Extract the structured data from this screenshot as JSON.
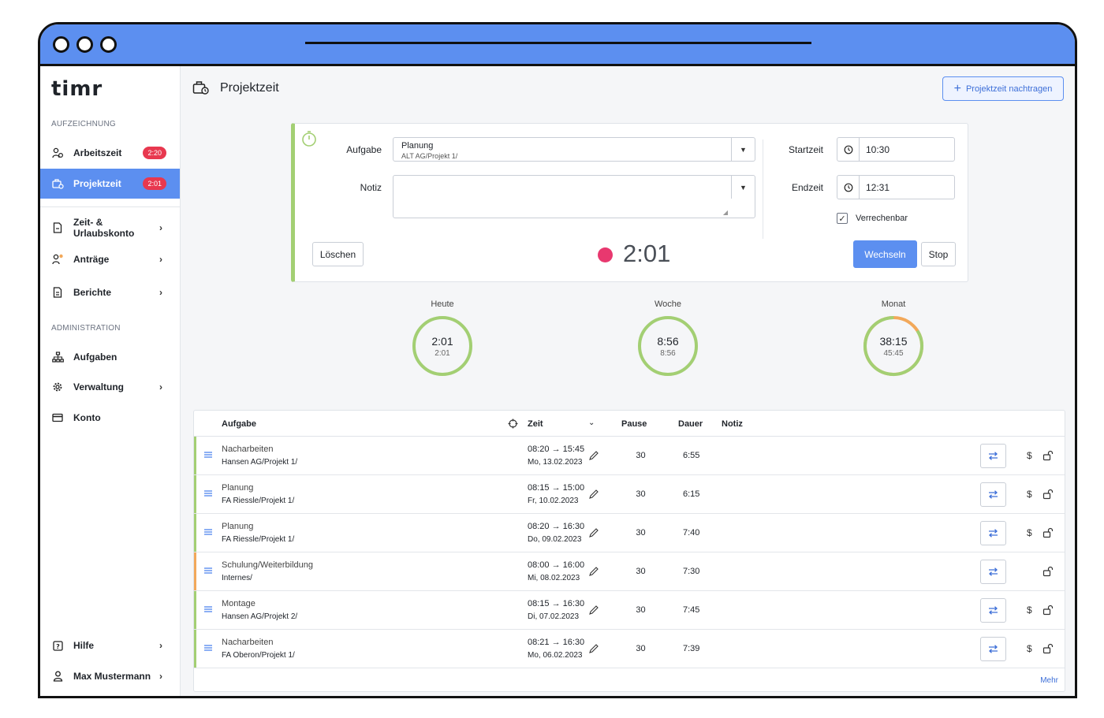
{
  "app": {
    "logo": "timr"
  },
  "sidebar": {
    "section_recording": "AUFZEICHNUNG",
    "section_admin": "ADMINISTRATION",
    "items": [
      {
        "label": "Arbeitszeit",
        "badge": "2:20",
        "icon": "user-clock-icon"
      },
      {
        "label": "Projektzeit",
        "badge": "2:01",
        "icon": "briefcase-clock-icon"
      },
      {
        "label": "Zeit- & Urlaubskonto",
        "icon": "document-icon"
      },
      {
        "label": "Anträge",
        "icon": "user-request-icon"
      },
      {
        "label": "Berichte",
        "icon": "report-icon"
      },
      {
        "label": "Aufgaben",
        "icon": "hierarchy-icon"
      },
      {
        "label": "Verwaltung",
        "icon": "gear-icon"
      },
      {
        "label": "Konto",
        "icon": "card-icon"
      },
      {
        "label": "Hilfe",
        "icon": "help-icon"
      },
      {
        "label": "Max Mustermann",
        "icon": "user-icon"
      }
    ]
  },
  "header": {
    "title": "Projektzeit",
    "add_button": "Projektzeit nachtragen"
  },
  "timer": {
    "task_label": "Aufgabe",
    "task_value": "Planung",
    "task_sub": "ALT AG/Projekt 1/",
    "note_label": "Notiz",
    "note_value": "",
    "start_label": "Startzeit",
    "start_value": "10:30",
    "end_label": "Endzeit",
    "end_value": "12:31",
    "billable_label": "Verrechenbar",
    "billable_checked": true,
    "delete_button": "Löschen",
    "switch_button": "Wechseln",
    "stop_button": "Stop",
    "elapsed": "2:01",
    "record_color": "#e8386f"
  },
  "summary": [
    {
      "label": "Heute",
      "value": "2:01",
      "sub": "2:01",
      "fraction": 1.0
    },
    {
      "label": "Woche",
      "value": "8:56",
      "sub": "8:56",
      "fraction": 1.0
    },
    {
      "label": "Monat",
      "value": "38:15",
      "sub": "45:45",
      "fraction": 0.84
    }
  ],
  "table": {
    "columns": {
      "task": "Aufgabe",
      "time": "Zeit",
      "pause": "Pause",
      "duration": "Dauer",
      "note": "Notiz"
    },
    "more": "Mehr",
    "rows": [
      {
        "task": "Nacharbeiten",
        "project": "Hansen AG/Projekt 1/",
        "range": "08:20 → 15:45",
        "date": "Mo, 13.02.2023",
        "pause": "30",
        "duration": "6:55",
        "billable": true,
        "color": "#a3cf73"
      },
      {
        "task": "Planung",
        "project": "FA Riessle/Projekt 1/",
        "range": "08:15 → 15:00",
        "date": "Fr, 10.02.2023",
        "pause": "30",
        "duration": "6:15",
        "billable": true,
        "color": "#a3cf73"
      },
      {
        "task": "Planung",
        "project": "FA Riessle/Projekt 1/",
        "range": "08:20 → 16:30",
        "date": "Do, 09.02.2023",
        "pause": "30",
        "duration": "7:40",
        "billable": true,
        "color": "#a3cf73"
      },
      {
        "task": "Schulung/Weiterbildung",
        "project": "Internes/",
        "range": "08:00 → 16:00",
        "date": "Mi, 08.02.2023",
        "pause": "30",
        "duration": "7:30",
        "billable": false,
        "color": "#f2a85a"
      },
      {
        "task": "Montage",
        "project": "Hansen AG/Projekt 2/",
        "range": "08:15 → 16:30",
        "date": "Di, 07.02.2023",
        "pause": "30",
        "duration": "7:45",
        "billable": true,
        "color": "#a3cf73"
      },
      {
        "task": "Nacharbeiten",
        "project": "FA Oberon/Projekt 1/",
        "range": "08:21 → 16:30",
        "date": "Mo, 06.02.2023",
        "pause": "30",
        "duration": "7:39",
        "billable": true,
        "color": "#a3cf73"
      }
    ]
  },
  "colors": {
    "accent": "#5c8ff0",
    "ring_ok": "#a3cf73",
    "ring_warn": "#f2a85a",
    "badge": "#e8384f"
  }
}
